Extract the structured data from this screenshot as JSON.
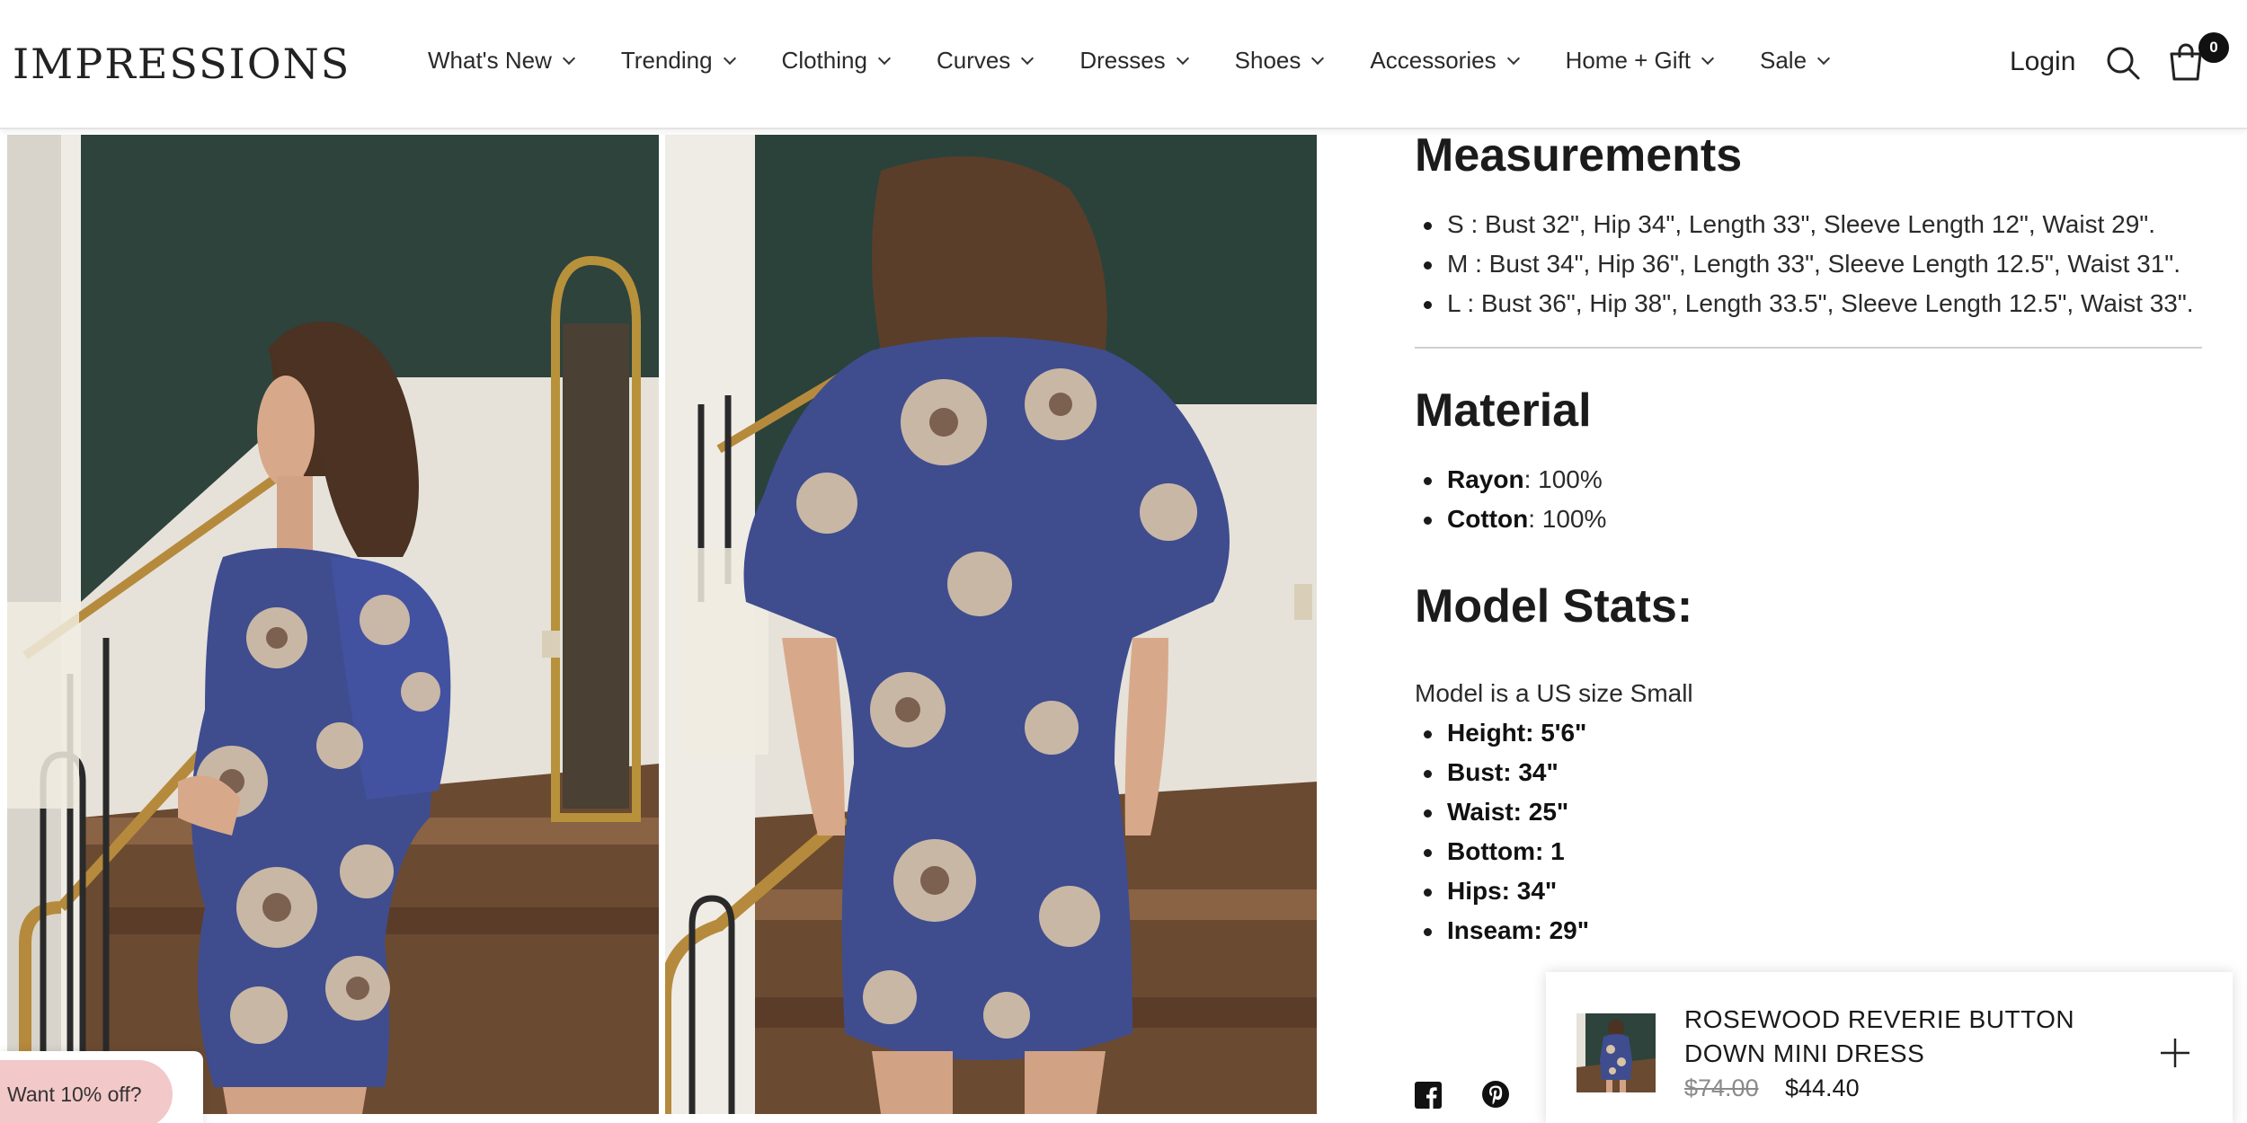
{
  "header": {
    "logo": "IMPRESSIONS",
    "nav": [
      "What's New",
      "Trending",
      "Clothing",
      "Curves",
      "Dresses",
      "Shoes",
      "Accessories",
      "Home + Gift",
      "Sale"
    ],
    "login": "Login",
    "cart_count": "0"
  },
  "details": {
    "measurements_title": "Measurements",
    "measurements": [
      "S : Bust 32\", Hip 34\", Length 33\", Sleeve Length 12\", Waist 29\".",
      "M : Bust 34\", Hip 36\", Length 33\", Sleeve Length 12.5\", Waist 31\".",
      "L : Bust 36\", Hip 38\", Length 33.5\", Sleeve Length 12.5\", Waist 33\"."
    ],
    "material_title": "Material",
    "materials": [
      {
        "name": "Rayon",
        "value": ": 100%"
      },
      {
        "name": "Cotton",
        "value": ": 100%"
      }
    ],
    "model_title": "Model Stats:",
    "model_intro": "Model is a US size Small",
    "model_stats": [
      "Height: 5'6\"",
      "Bust: 34\"",
      "Waist: 25\"",
      "Bottom: 1",
      "Hips: 34\"",
      "Inseam: 29\""
    ]
  },
  "sticky_cart": {
    "title": "ROSEWOOD REVERIE BUTTON DOWN MINI DRESS",
    "price_old": "$74.00",
    "price_new": "$44.40"
  },
  "discount_tab": "Want 10% off?",
  "colors": {
    "dress_blue": "#3f4d8e",
    "wall_green": "#29403a",
    "discount_pink": "#f2c8c8"
  }
}
